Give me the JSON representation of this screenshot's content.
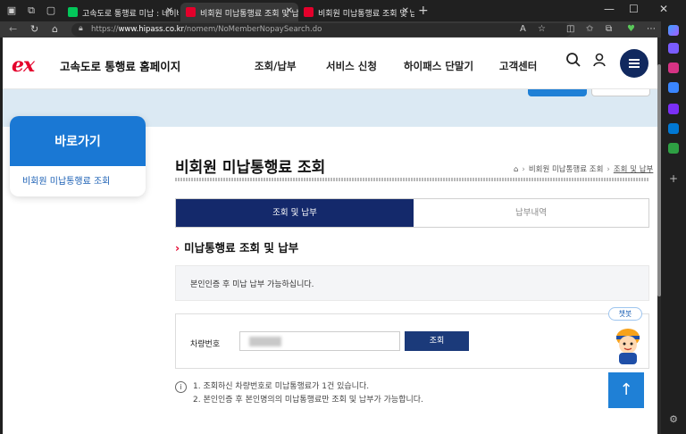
{
  "browser": {
    "tabs": [
      {
        "label": "고속도로 통행료 미납 : 네이버 통",
        "active": false,
        "favicon_color": "#03c75a"
      },
      {
        "label": "비회원 미납통행료 조회 및 납부",
        "active": true,
        "favicon_color": "#e4002b"
      },
      {
        "label": "비회원 미납통행료 조회 및 납부",
        "active": false,
        "favicon_color": "#e4002b"
      }
    ],
    "url_prefix": "https://",
    "url_host": "www.hipass.co.kr",
    "url_path": "/nomem/NoMemberNopaySearch.do",
    "new_tab": "+",
    "window_controls": {
      "minimize": "—",
      "maximize": "☐",
      "close": "✕"
    }
  },
  "site": {
    "logo": "ex",
    "logo_text": "고속도로 통행료 홈페이지",
    "brand_color": "#e4002b",
    "nav": [
      "조회/납부",
      "서비스 신청",
      "하이패스 단말기",
      "고객센터"
    ]
  },
  "quick_nav": {
    "title": "바로가기",
    "item": "비회원 미납통행료 조회"
  },
  "main": {
    "title": "비회원 미납통행료 조회",
    "breadcrumb": [
      "비회원 미납통행료 조회",
      "조회 및 납부"
    ],
    "tabs": [
      "조회 및 납부",
      "납부내역"
    ],
    "section_title": "미납통행료 조회 및 납부",
    "notice": "본인인증 후 미납 납부 가능하십니다.",
    "form": {
      "label": "차량번호",
      "button": "조회"
    },
    "info": [
      "1. 조회하신 차량번호로 미납통행료가 1건 있습니다.",
      "2. 본인인증 후 본인명의의 미납통행료만 조회 및 납부가 가능합니다."
    ],
    "info_icon": "i"
  },
  "floating": {
    "chatbot_label": "챗봇",
    "top_button": "↑"
  }
}
